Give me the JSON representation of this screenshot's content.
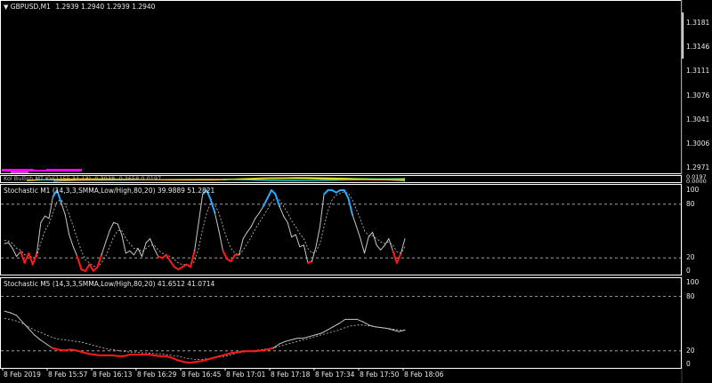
{
  "colors": {
    "background": "#000000",
    "frame": "#ffffff",
    "stoch_line": "#c8c8c8",
    "oversold": "#ff1a1a",
    "overbought": "#2aa8ff",
    "inset_magenta": "#ff00ff"
  },
  "main": {
    "title_icon": "triangle-down-icon",
    "symbol_line": "GBPUSD,M1",
    "ohlc": "1.2939 1.2940 1.2939 1.2940",
    "price_ticks": [
      "1.3181",
      "1.3146",
      "1.3111",
      "1.3076",
      "1.3041",
      "1.3006",
      "1.2971"
    ]
  },
  "indicator_strip": {
    "label": "Kol Bullish MT  KV(1155,34,13) -0.3938 -0.3658 0.0197",
    "tick_top": "0.0197",
    "tick_bottom": "0.0000"
  },
  "stoch_m1": {
    "label": "Stochastic M1 (14,3,3,SMMA,Low/High,80,20) 39.9889 51.2821",
    "ticks": [
      "100",
      "80",
      "20",
      "0"
    ]
  },
  "stoch_m5": {
    "label": "Stochastic M5 (14,3,3,SMMA,Low/High,80,20) 41.6512 41.0714",
    "ticks": [
      "100",
      "80",
      "20",
      "0"
    ]
  },
  "time_axis": [
    "8 Feb 2019",
    "8 Feb 15:57",
    "8 Feb 16:13",
    "8 Feb 16:29",
    "8 Feb 16:45",
    "8 Feb 17:01",
    "8 Feb 17:18",
    "8 Feb 17:34",
    "8 Feb 17:50",
    "8 Feb 18:06"
  ],
  "chart_data": [
    {
      "type": "line",
      "title": "Stochastic M1 (14,3,3,SMMA,Low/High,80,20) 39.9889 51.2821",
      "x_unit": "bar index",
      "ylim": [
        0,
        100
      ],
      "levels": [
        80,
        20
      ],
      "series": [
        {
          "values": [
            34,
            35,
            28,
            18,
            24,
            10,
            22,
            8,
            22,
            60,
            68,
            65,
            92,
            100,
            85,
            70,
            45,
            30,
            18,
            2,
            0,
            8,
            0,
            5,
            20,
            35,
            50,
            60,
            58,
            45,
            22,
            25,
            20,
            28,
            18,
            35,
            40,
            28,
            18,
            16,
            20,
            12,
            5,
            2,
            5,
            8,
            5,
            25,
            60,
            95,
            100,
            88,
            72,
            50,
            25,
            15,
            12,
            20,
            20,
            40,
            48,
            55,
            65,
            72,
            80,
            90,
            100,
            95,
            80,
            68,
            60,
            42,
            45,
            30,
            32,
            10,
            12,
            30,
            55,
            95,
            100,
            100,
            97,
            100,
            100,
            90,
            70,
            55,
            40,
            22,
            42,
            48,
            32,
            26,
            32,
            40,
            25,
            10,
            22,
            40
          ]
        },
        {
          "values": [
            38,
            37,
            34,
            28,
            26,
            20,
            20,
            16,
            18,
            35,
            50,
            58,
            72,
            86,
            88,
            82,
            70,
            55,
            40,
            25,
            14,
            10,
            6,
            5,
            10,
            18,
            30,
            42,
            50,
            50,
            40,
            34,
            28,
            28,
            24,
            28,
            32,
            32,
            26,
            22,
            20,
            18,
            14,
            10,
            8,
            8,
            7,
            12,
            28,
            52,
            72,
            84,
            82,
            72,
            55,
            40,
            28,
            22,
            20,
            26,
            34,
            42,
            52,
            60,
            68,
            76,
            85,
            90,
            88,
            80,
            72,
            62,
            55,
            46,
            40,
            28,
            22,
            24,
            34,
            55,
            75,
            88,
            94,
            96,
            98,
            96,
            88,
            76,
            64,
            50,
            44,
            44,
            40,
            36,
            34,
            36,
            32,
            24,
            22,
            30
          ]
        }
      ]
    },
    {
      "type": "line",
      "title": "Stochastic M5 (14,3,3,SMMA,Low/High,80,20) 41.6512 41.0714",
      "x_unit": "bar index",
      "ylim": [
        0,
        100
      ],
      "levels": [
        80,
        20
      ],
      "series": [
        {
          "values": [
            65,
            63,
            60,
            52,
            44,
            36,
            30,
            25,
            20,
            18,
            17,
            18,
            17,
            15,
            13,
            12,
            11,
            11,
            11,
            10,
            10,
            12,
            12,
            12,
            12,
            11,
            10,
            10,
            8,
            5,
            3,
            2,
            3,
            4,
            6,
            8,
            10,
            12,
            14,
            15,
            16,
            16,
            16,
            17,
            18,
            20,
            25,
            28,
            30,
            32,
            32,
            34,
            36,
            38,
            42,
            46,
            50,
            55,
            55,
            55,
            52,
            48,
            46,
            45,
            44,
            42,
            40,
            42
          ]
        },
        {
          "values": [
            56,
            55,
            53,
            50,
            46,
            42,
            39,
            36,
            33,
            31,
            30,
            29,
            28,
            27,
            25,
            23,
            21,
            19,
            18,
            17,
            16,
            15,
            15,
            14,
            14,
            13,
            13,
            12,
            11,
            10,
            8,
            7,
            6,
            6,
            7,
            8,
            9,
            10,
            12,
            14,
            15,
            16,
            17,
            18,
            19,
            20,
            22,
            24,
            26,
            28,
            30,
            32,
            34,
            36,
            38,
            40,
            42,
            45,
            47,
            48,
            48,
            47,
            46,
            45,
            44,
            43,
            42,
            42
          ]
        }
      ]
    }
  ]
}
